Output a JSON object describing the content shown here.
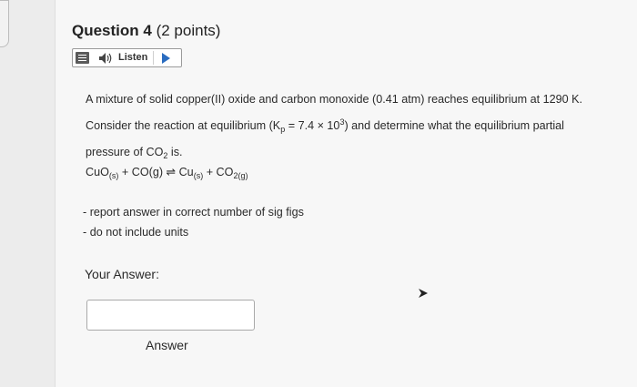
{
  "question": {
    "name": "Question 4",
    "points": "(2 points)"
  },
  "toolbar": {
    "menu_icon": "menu-icon",
    "speaker_icon": "speaker-icon",
    "listen_label": "Listen",
    "play_icon": "play-icon"
  },
  "prompt": {
    "line1_pre": "A mixture of solid copper(II) oxide and carbon monoxide (0.41 atm) reaches equilibrium at 1290 K.",
    "line2_a": "Consider the reaction at equilibrium (K",
    "line2_sub": "p",
    "line2_b": " = 7.4 × 10",
    "line2_sup": "3",
    "line2_c": ") and determine what the equilibrium partial",
    "line3_a": "pressure of CO",
    "line3_sub": "2",
    "line3_b": " is."
  },
  "equation": {
    "t1": "CuO",
    "s1": "(s)",
    "t2": " + CO(g) ⇌ Cu",
    "s2": "(s)",
    "t3": " + CO",
    "s3": "2(g)"
  },
  "notes": {
    "n1": "- report answer in correct number of sig figs",
    "n2": "- do not include units"
  },
  "answer": {
    "heading": "Your Answer:",
    "value": "",
    "label": "Answer"
  },
  "colors": {
    "background": "#ececec",
    "card": "#f7f7f7",
    "play_accent": "#2a6cc0"
  }
}
